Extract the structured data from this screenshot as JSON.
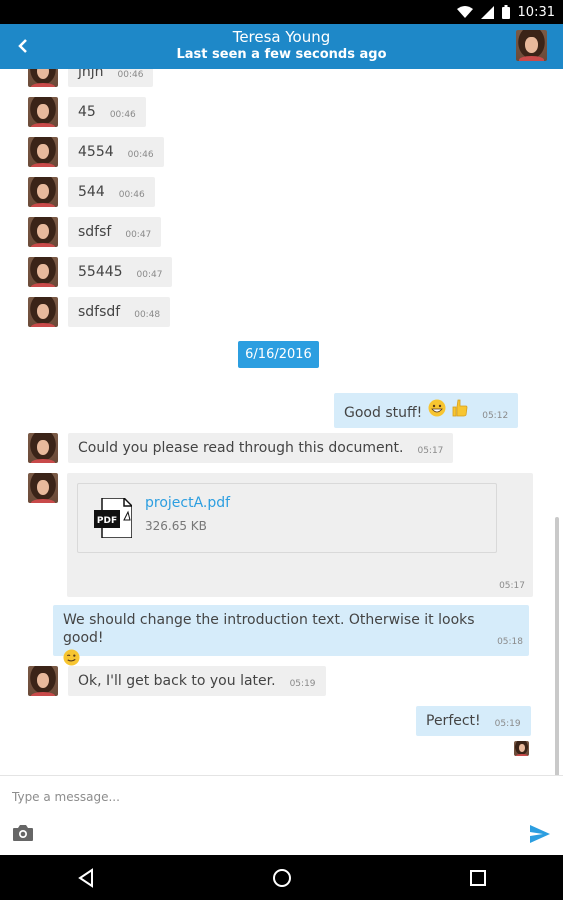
{
  "status_bar": {
    "time": "10:31"
  },
  "header": {
    "contact_name": "Teresa Young",
    "last_seen": "Last seen a few seconds ago"
  },
  "messages": [
    {
      "text": "jnjn",
      "time": "00:46"
    },
    {
      "text": "45",
      "time": "00:46"
    },
    {
      "text": "4554",
      "time": "00:46"
    },
    {
      "text": "544",
      "time": "00:46"
    },
    {
      "text": "sdfsf",
      "time": "00:47"
    },
    {
      "text": "55445",
      "time": "00:47"
    },
    {
      "text": "sdfsdf",
      "time": "00:48"
    }
  ],
  "date_separator": "6/16/2016",
  "outgoing_1": {
    "text": "Good stuff!",
    "time": "05:12",
    "emojis": [
      "grinning-face",
      "thumbs-up"
    ]
  },
  "incoming_doc_request": {
    "text": "Could you please read through this document.",
    "time": "05:17"
  },
  "file_message": {
    "file_name": "projectA.pdf",
    "file_size": "326.65 KB",
    "file_type": "PDF",
    "time": "05:17"
  },
  "outgoing_2": {
    "text": "We should change the introduction text. Otherwise it looks good!",
    "time": "05:18",
    "emoji": "winking-face"
  },
  "incoming_reply": {
    "text": "Ok, I'll get back to you later.",
    "time": "05:19"
  },
  "outgoing_3": {
    "text": "Perfect!",
    "time": "05:19"
  },
  "composer": {
    "placeholder": "Type a message..."
  },
  "colors": {
    "header": "#1e88c8",
    "accent": "#2c9ee0",
    "incoming_bubble": "#efefef",
    "outgoing_bubble": "#d6ecfa"
  }
}
